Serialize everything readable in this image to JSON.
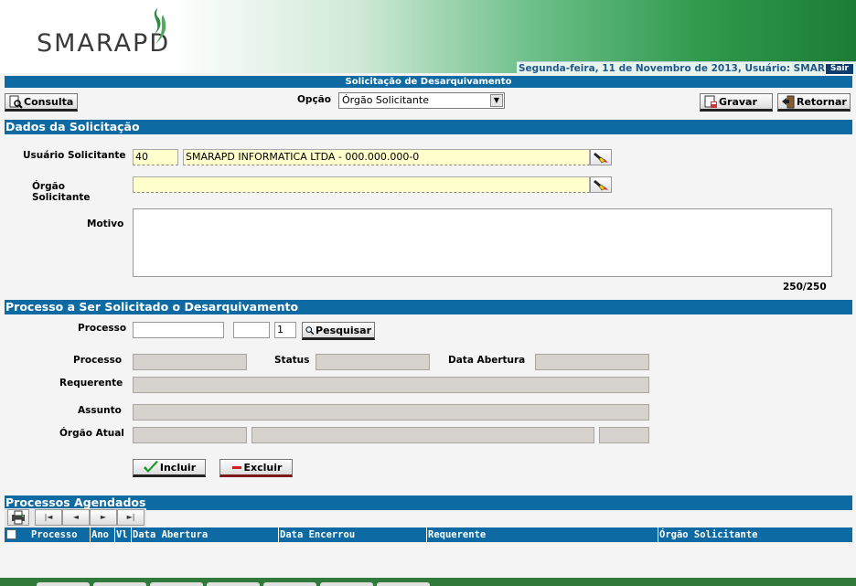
{
  "header": {
    "logo": "SMARAPD",
    "date_line": "Segunda-feira, 11 de Novembro de 2013, Usuário: SMAR",
    "sair": "Sair"
  },
  "page": {
    "title": "Solicitação de Desarquivamento"
  },
  "toolbar": {
    "consulta": "Consulta",
    "opcao_label": "Opção",
    "opcao_value": "Órgão Solicitante",
    "gravar": "Gravar",
    "retornar": "Retornar"
  },
  "dados": {
    "section_title": "Dados da Solicitação",
    "usuario_label": "Usuário Solicitante",
    "usuario_code": "40",
    "usuario_name": "SMARAPD INFORMATICA LTDA - 000.000.000-0",
    "orgao_label_1": "Órgão",
    "orgao_label_2": "Solicitante",
    "orgao_value": "",
    "motivo_label": "Motivo",
    "motivo_value": "",
    "motivo_counter": "250/250"
  },
  "processo": {
    "section_title": "Processo a Ser Solicitado o Desarquivamento",
    "processo_label": "Processo",
    "processo_value": "",
    "ano_value": "",
    "seq_value": "1",
    "pesquisar": "Pesquisar",
    "proc_ro_label": "Processo",
    "status_label": "Status",
    "data_abertura_label": "Data Abertura",
    "requerente_label": "Requerente",
    "assunto_label": "Assunto",
    "orgao_atual_label": "Órgão Atual",
    "incluir": "Incluir",
    "excluir": "Excluir"
  },
  "agendados": {
    "section_title": "Processos Agendados",
    "nav": [
      "|◄",
      "◄",
      "►",
      "►|"
    ],
    "columns": [
      "Processo",
      "Ano",
      "Vl",
      "Data Abertura",
      "Data Encerrou",
      "Requerente",
      "Órgão Solicitante"
    ]
  },
  "colors": {
    "bar_blue": "#0d6aa3",
    "header_green": "#1b7d34",
    "readonly_gray": "#d6d3ce",
    "lookup_yellow": "#ffffcc"
  }
}
